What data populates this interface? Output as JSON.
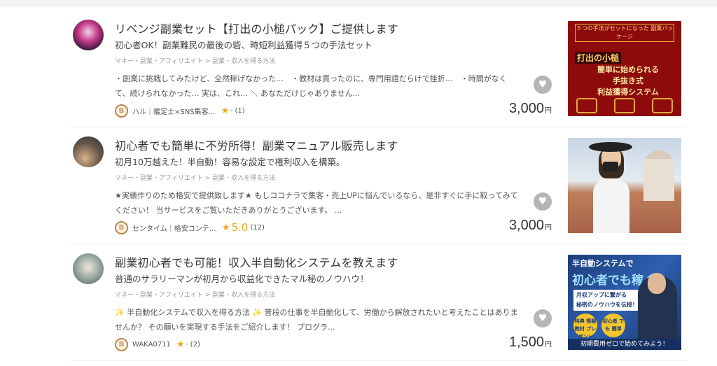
{
  "listings": [
    {
      "title": "リベンジ副業セット【打出の小槌パック】ご提供します",
      "subtitle": "初心者OK！副業難民の最後の砦、時短利益獲得５つの手法セット",
      "category": "マネー・副業・アフィリエイト > 副業・収入を得る方法",
      "description": "・副業に挑戦してみたけど、全然稼げなかった…　・教材は買ったのに、専門用語だらけで挫折…　・時間がなくて、続けられなかった… 実は、これ… ＼ あなただけじゃありません...",
      "rank_badge": "B",
      "seller": "ハル｜鑑定士×SNS集客…",
      "rating": "-",
      "reviews": "(1)",
      "price": "3,000",
      "price_unit": "円",
      "thumb_text": {
        "ribbon": "５つの手法がセットになった 副業パッケージ",
        "main": "打出の小槌",
        "lines": [
          "簡単に始められる",
          "手抜き式",
          "利益獲得システム"
        ]
      },
      "avatar_icon": "user-avatar-icon"
    },
    {
      "title": "初心者でも簡単に不労所得！副業マニュアル販売します",
      "subtitle": "初月10万越えた！半自動！容易な設定で権利収入を構築。",
      "category": "マネー・副業・アフィリエイト > 副業・収入を得る方法",
      "description": "★実績作りのため格安で提供致します★ もしココナラで集客・売上UPに悩んでいるなら、是非すぐに手に取ってみてください！ 当サービスをご覧いただきありがとうございます。 ...",
      "rank_badge": "B",
      "seller": "センタイム｜格安コンテ…",
      "rating": "5.0",
      "reviews": "(12)",
      "price": "3,000",
      "price_unit": "円",
      "avatar_icon": "user-avatar-icon"
    },
    {
      "title": "副業初心者でも可能！収入半自動化システムを教えます",
      "subtitle": "普通のサラリーマンが初月から収益化できたマル秘のノウハウ！",
      "category": "マネー・副業・アフィリエイト > 副業・収入を得る方法",
      "description": "✨ 半自動化システムで収入を得る方法 ✨ 普段の仕事を半自動化して、労働から解放されたいと考えたことはありませんか？ その願いを実現する手法をご紹介します！ プログラ...",
      "rank_badge": "B",
      "seller": "WAKA0711",
      "rating": "-",
      "reviews": "(2)",
      "price": "1,500",
      "price_unit": "円",
      "thumb_text": {
        "h1": "半自動システムで",
        "h2": "初心者でも稼ぐ",
        "box": [
          "月収アップに繋がる",
          "秘密のノウハウを伝授！"
        ],
        "c1": "特典 情報教材 プレゼント",
        "c2": "初心者 でも 簡単",
        "footer": "初期費用ゼロで始めてみよう！"
      },
      "avatar_icon": "user-avatar-icon"
    }
  ],
  "icons": {
    "favorite": "heart-icon",
    "star": "star-icon"
  },
  "colors": {
    "star": "#f2a51c",
    "badge": "#b8864b",
    "fav": "#b5b5b5"
  }
}
